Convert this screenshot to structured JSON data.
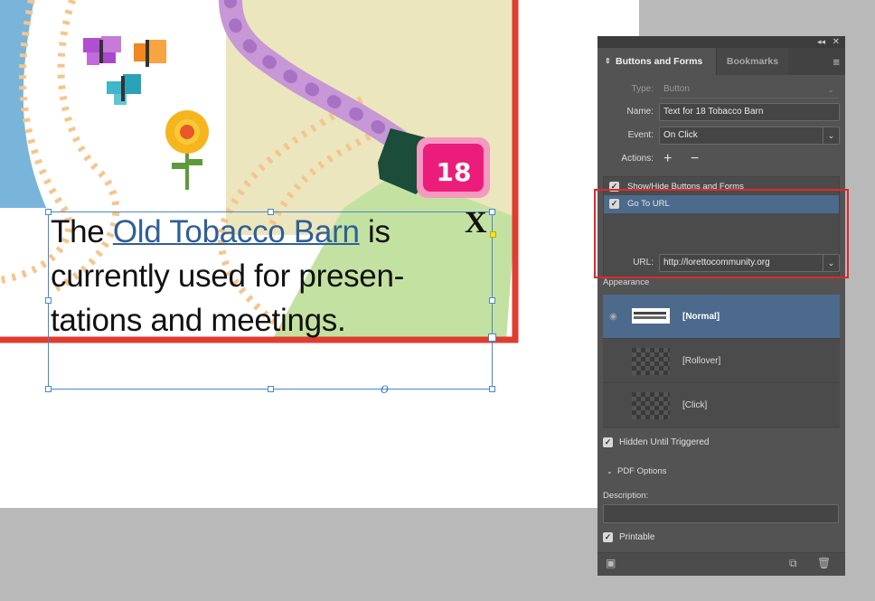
{
  "document": {
    "text_before_link": "The ",
    "link_text": "Old Tobacco Barn",
    "text_after_link": " is currently used for presen-tations and meetings.",
    "close_glyph": "X",
    "badge_number": "18"
  },
  "panel": {
    "tabs": [
      {
        "label": "Buttons and Forms",
        "active": true
      },
      {
        "label": "Bookmarks",
        "active": false
      }
    ],
    "type": {
      "label": "Type:",
      "value": "Button"
    },
    "name": {
      "label": "Name:",
      "value": "Text for 18 Tobacco Barn"
    },
    "event": {
      "label": "Event:",
      "value": "On Click"
    },
    "actions_label": "Actions:",
    "add_glyph": "+",
    "remove_glyph": "−",
    "actions": [
      {
        "label": "Show/Hide Buttons and Forms",
        "checked": true,
        "selected": false
      },
      {
        "label": "Go To URL",
        "checked": true,
        "selected": true
      }
    ],
    "url": {
      "label": "URL:",
      "value": "http://lorettocommunity.org"
    },
    "appearance_label": "Appearance",
    "states": [
      {
        "label": "[Normal]",
        "selected": true
      },
      {
        "label": "[Rollover]",
        "selected": false
      },
      {
        "label": "[Click]",
        "selected": false
      }
    ],
    "hidden_until_triggered": {
      "label": "Hidden Until Triggered",
      "checked": true
    },
    "pdf_options_label": "PDF Options",
    "description_label": "Description:",
    "description_value": "",
    "printable": {
      "label": "Printable",
      "checked": true
    }
  },
  "colors": {
    "highlight_red": "#e4262b",
    "selection_blue": "#4c6a8c",
    "link_blue": "#2f5f96",
    "badge_pink": "#ec1c7a",
    "map_border_red": "#e03c31"
  }
}
